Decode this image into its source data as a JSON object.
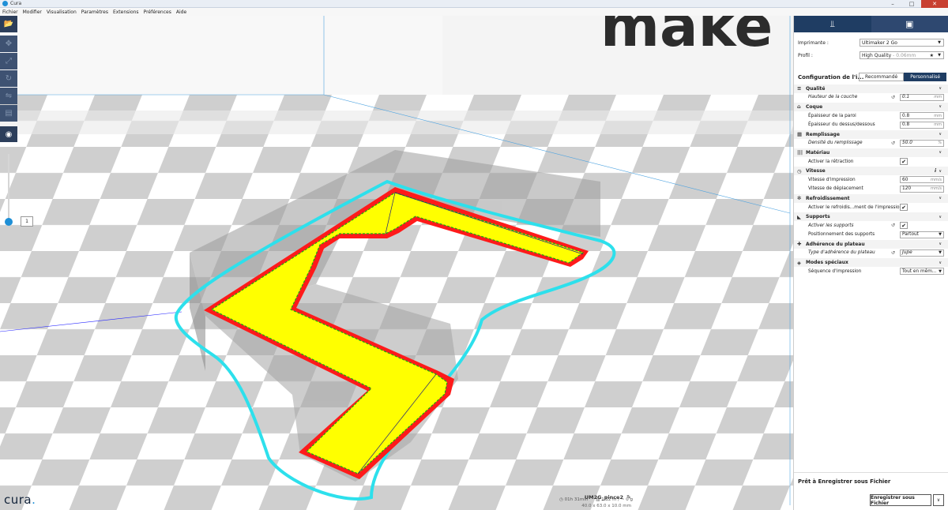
{
  "window": {
    "title": "Cura",
    "controls": [
      "–",
      "□",
      "✕"
    ]
  },
  "menu": [
    "Fichier",
    "Modifier",
    "Visualisation",
    "Paramètres",
    "Extensions",
    "Préférences",
    "Aide"
  ],
  "left_toolbar": {
    "open_icon": "folder-open-icon",
    "tools": [
      "move-icon",
      "scale-icon",
      "rotate-icon",
      "mirror-icon",
      "per-model-settings-icon"
    ],
    "view_icon": "eye-icon",
    "layer_number": "1",
    "layer_level": 0
  },
  "logo": {
    "text": "cura",
    "dot": "."
  },
  "job": {
    "name": "UM2G_pince2",
    "dimensions": "40.0 x 63.0 x 10.0 mm",
    "time": "01h 31min",
    "material": "1.12 m / ~ 0 g"
  },
  "sidebar": {
    "tabs": [
      "print-setup-icon",
      "monitor-icon"
    ],
    "printer_label": "Imprimante :",
    "printer_value": "Ultimaker 2 Go",
    "profile_label": "Profil :",
    "profile_value": "High Quality",
    "profile_sub": "- 0.06mm",
    "config_title": "Configuration de l'i...",
    "mode_recommended": "Recommandé",
    "mode_custom": "Personnalisé",
    "categories": [
      {
        "id": "quality",
        "icon": "≡",
        "label": "Qualité",
        "settings": [
          {
            "label": "Hauteur de la couche",
            "italic": true,
            "reset": true,
            "type": "value",
            "value": "0.1",
            "unit": "mm"
          }
        ]
      },
      {
        "id": "shell",
        "icon": "⌂",
        "label": "Coque",
        "settings": [
          {
            "label": "Épaisseur de la paroi",
            "type": "value",
            "value": "0.8",
            "unit": "mm"
          },
          {
            "label": "Épaisseur du dessus/dessous",
            "type": "value",
            "value": "0.8",
            "unit": "mm"
          }
        ]
      },
      {
        "id": "infill",
        "icon": "▦",
        "label": "Remplissage",
        "settings": [
          {
            "label": "Densité du remplissage",
            "italic": true,
            "reset": true,
            "type": "value",
            "value": "50.0",
            "unit": "%"
          }
        ]
      },
      {
        "id": "material",
        "icon": "|||",
        "label": "Matériau",
        "settings": [
          {
            "label": "Activer la rétraction",
            "type": "check",
            "value": "✔"
          }
        ]
      },
      {
        "id": "speed",
        "icon": "◷",
        "label": "Vitesse",
        "info": "i",
        "settings": [
          {
            "label": "Vitesse d'impression",
            "type": "value",
            "value": "60",
            "unit": "mm/s"
          },
          {
            "label": "Vitesse de déplacement",
            "type": "value",
            "value": "120",
            "unit": "mm/s"
          }
        ]
      },
      {
        "id": "cooling",
        "icon": "✻",
        "label": "Refroidissement",
        "settings": [
          {
            "label": "Activer le refroidis...ment de l'impression",
            "type": "check",
            "value": "✔"
          }
        ]
      },
      {
        "id": "support",
        "icon": "◣",
        "label": "Supports",
        "settings": [
          {
            "label": "Activer les supports",
            "italic": true,
            "reset": true,
            "type": "check",
            "value": "✔"
          },
          {
            "label": "Positionnement des supports",
            "type": "select",
            "value": "Partout"
          }
        ]
      },
      {
        "id": "adhesion",
        "icon": "✚",
        "label": "Adhérence du plateau",
        "settings": [
          {
            "label": "Type d'adhérence du plateau",
            "italic": true,
            "reset": true,
            "type": "select",
            "value": "Jupe"
          }
        ]
      },
      {
        "id": "special",
        "icon": "◈",
        "label": "Modes spéciaux",
        "settings": [
          {
            "label": "Séquence d'impression",
            "type": "select",
            "value": "Tout en mêm..."
          }
        ]
      }
    ],
    "ready_text": "Prêt à Enregistrer sous Fichier",
    "save_button": "Enregistrer sous Fichier"
  },
  "colors": {
    "accent": "#1e8fd6",
    "dark_blue": "#1f3d63",
    "skirt": "#2de0ec",
    "infill": "#ffff00",
    "outer_wall": "#e02020",
    "inner_wall": "#10b010",
    "close_button": "#c84031"
  }
}
